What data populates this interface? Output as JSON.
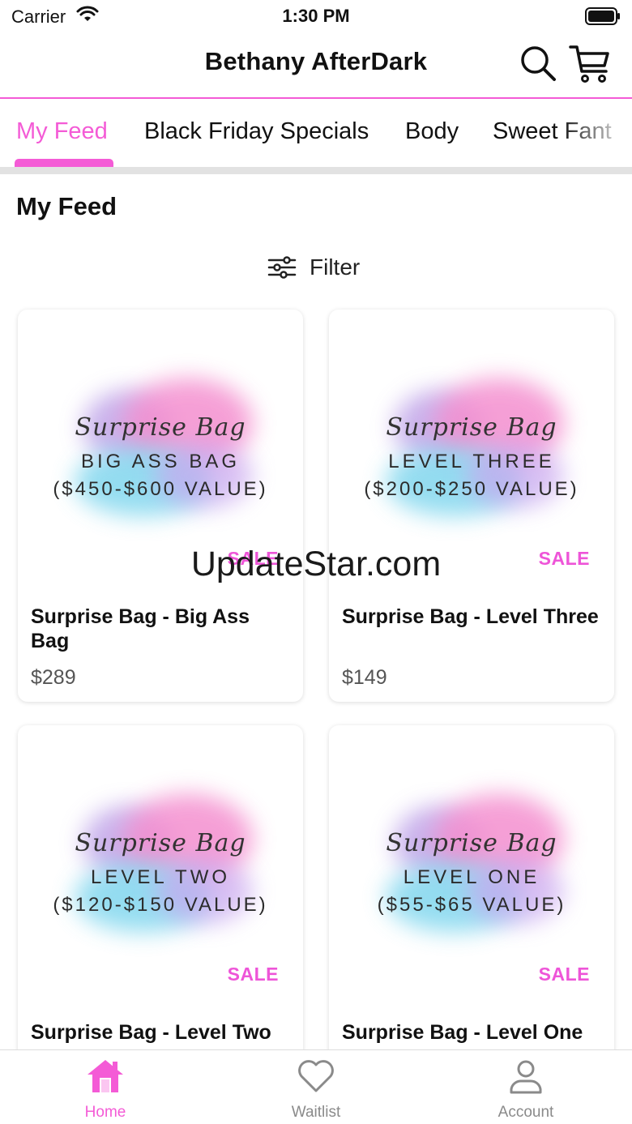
{
  "status_bar": {
    "carrier": "Carrier",
    "time": "1:30 PM"
  },
  "header": {
    "title": "Bethany AfterDark",
    "search_icon": "search-icon",
    "cart_icon": "cart-icon"
  },
  "tabs": [
    {
      "label": "My Feed",
      "active": true
    },
    {
      "label": "Black Friday Specials",
      "active": false
    },
    {
      "label": "Body",
      "active": false
    },
    {
      "label": "Sweet Fant",
      "active": false
    }
  ],
  "section_title": "My Feed",
  "filter": {
    "label": "Filter",
    "icon": "sliders-icon"
  },
  "products": [
    {
      "image_script": "Surprise Bag",
      "image_line1": "BIG ASS BAG",
      "image_line2": "($450-$600 VALUE)",
      "badge": "SALE",
      "title": "Surprise Bag - Big Ass Bag",
      "price": "$289"
    },
    {
      "image_script": "Surprise Bag",
      "image_line1": "LEVEL THREE",
      "image_line2": "($200-$250 VALUE)",
      "badge": "SALE",
      "title": "Surprise Bag - Level Three",
      "price": "$149"
    },
    {
      "image_script": "Surprise Bag",
      "image_line1": "LEVEL TWO",
      "image_line2": "($120-$150 VALUE)",
      "badge": "SALE",
      "title": "Surprise Bag - Level Two",
      "price": ""
    },
    {
      "image_script": "Surprise Bag",
      "image_line1": "LEVEL ONE",
      "image_line2": "($55-$65 VALUE)",
      "badge": "SALE",
      "title": "Surprise Bag - Level One",
      "price": ""
    }
  ],
  "watermark": "UpdateStar.com",
  "bottom_nav": [
    {
      "label": "Home",
      "icon": "home-icon",
      "active": true
    },
    {
      "label": "Waitlist",
      "icon": "heart-icon",
      "active": false
    },
    {
      "label": "Account",
      "icon": "user-icon",
      "active": false
    }
  ],
  "colors": {
    "accent": "#f45bd6",
    "sale": "#ee55d8",
    "divider": "#e2e2e2"
  }
}
